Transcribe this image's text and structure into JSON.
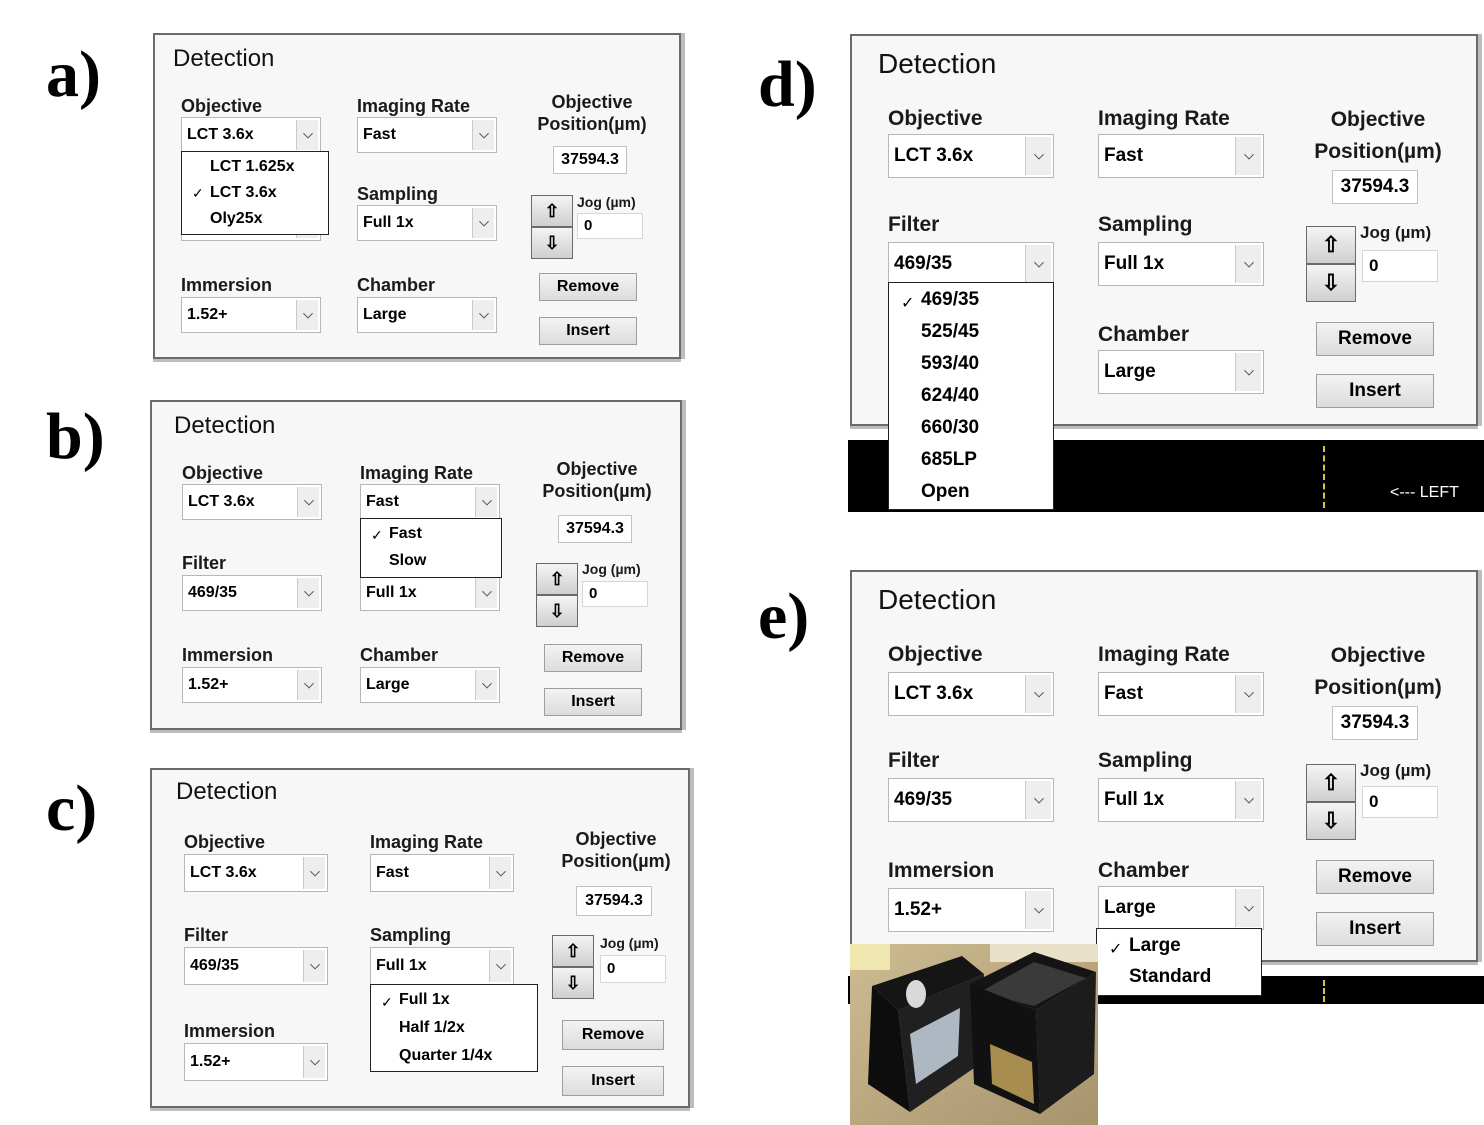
{
  "labels": {
    "detection": "Detection",
    "objective": "Objective",
    "imaging_rate": "Imaging Rate",
    "objective_position_1": "Objective",
    "objective_position_2": "Position(µm)",
    "filter": "Filter",
    "sampling": "Sampling",
    "immersion": "Immersion",
    "chamber": "Chamber",
    "jog": "Jog (µm)",
    "remove": "Remove",
    "insert": "Insert",
    "up_glyph": "⇧",
    "down_glyph": "⇩",
    "check_glyph": "✓"
  },
  "values": {
    "objective": "LCT 3.6x",
    "imaging_rate": "Fast",
    "filter": "469/35",
    "sampling": "Full 1x",
    "immersion": "1.52+",
    "chamber": "Large",
    "position": "37594.3",
    "jog": "0"
  },
  "panels": {
    "a": {
      "letter": "a)",
      "objective_menu": [
        "LCT 1.625x",
        "LCT 3.6x",
        "Oly25x"
      ]
    },
    "b": {
      "letter": "b)",
      "imaging_rate_menu": [
        "Fast",
        "Slow"
      ]
    },
    "c": {
      "letter": "c)",
      "sampling_menu": [
        "Full 1x",
        "Half 1/2x",
        "Quarter 1/4x"
      ]
    },
    "d": {
      "letter": "d)",
      "filter_menu": [
        "469/35",
        "525/45",
        "593/40",
        "624/40",
        "660/30",
        "685LP",
        "Open"
      ],
      "left_label": "<--- LEFT"
    },
    "e": {
      "letter": "e)",
      "chamber_menu": [
        "Large",
        "Standard"
      ]
    }
  },
  "colors": {
    "panel_bg": "#f7f7f7",
    "panel_border": "#6b6b6b",
    "button_bg": "#e6e6e6",
    "dashed_line": "#e0c040"
  }
}
